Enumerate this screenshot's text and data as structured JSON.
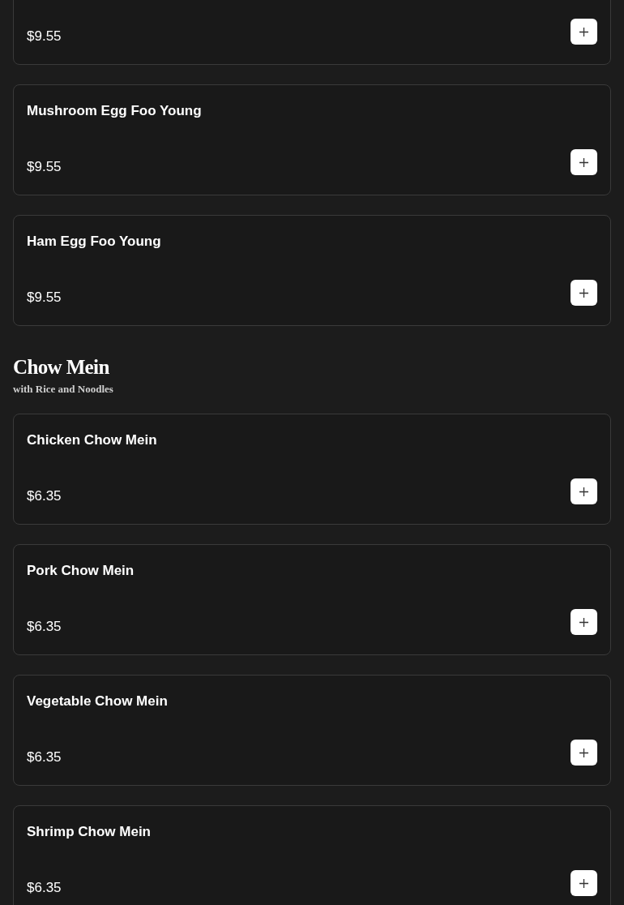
{
  "sections": [
    {
      "items": [
        {
          "price": "$9.55"
        },
        {
          "name": "Mushroom Egg Foo Young",
          "price": "$9.55"
        },
        {
          "name": "Ham Egg Foo Young",
          "price": "$9.55"
        }
      ]
    },
    {
      "title": "Chow Mein",
      "subtitle": "with Rice and Noodles",
      "items": [
        {
          "name": "Chicken Chow Mein",
          "price": "$6.35"
        },
        {
          "name": "Pork Chow Mein",
          "price": "$6.35"
        },
        {
          "name": "Vegetable Chow Mein",
          "price": "$6.35"
        },
        {
          "name": "Shrimp Chow Mein",
          "price": "$6.35"
        }
      ]
    }
  ]
}
